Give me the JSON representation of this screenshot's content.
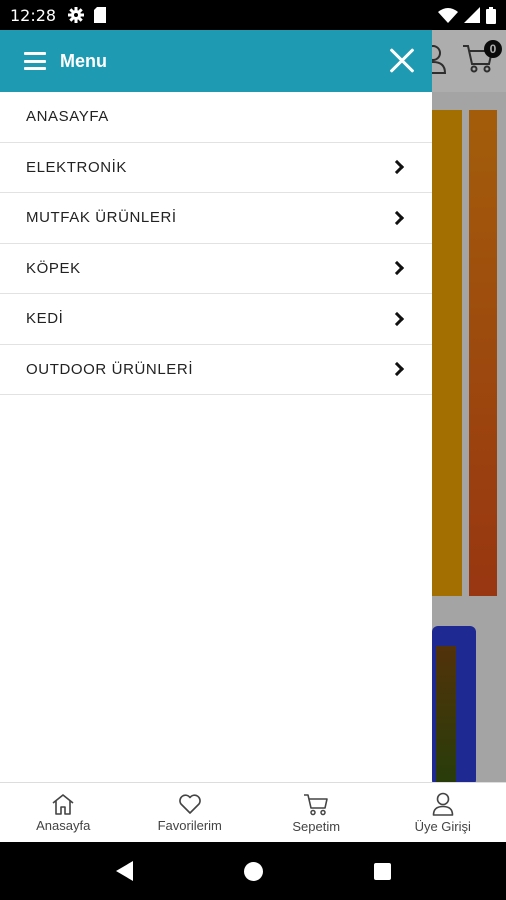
{
  "status_bar": {
    "time": "12:28"
  },
  "background": {
    "cart_count": "0"
  },
  "drawer": {
    "title": "Menu",
    "items": [
      {
        "label": "ANASAYFA",
        "has_children": false
      },
      {
        "label": "ELEKTRONİK",
        "has_children": true
      },
      {
        "label": "MUTFAK ÜRÜNLERİ",
        "has_children": true
      },
      {
        "label": "KÖPEK",
        "has_children": true
      },
      {
        "label": "KEDİ",
        "has_children": true
      },
      {
        "label": "OUTDOOR ÜRÜNLERİ",
        "has_children": true
      }
    ]
  },
  "bottom_nav": {
    "items": [
      {
        "label": "Anasayfa",
        "icon": "home-icon"
      },
      {
        "label": "Favorilerim",
        "icon": "heart-icon"
      },
      {
        "label": "Sepetim",
        "icon": "cart-icon"
      },
      {
        "label": "Üye Girişi",
        "icon": "user-icon"
      }
    ]
  },
  "colors": {
    "header": "#1e9ab3"
  }
}
